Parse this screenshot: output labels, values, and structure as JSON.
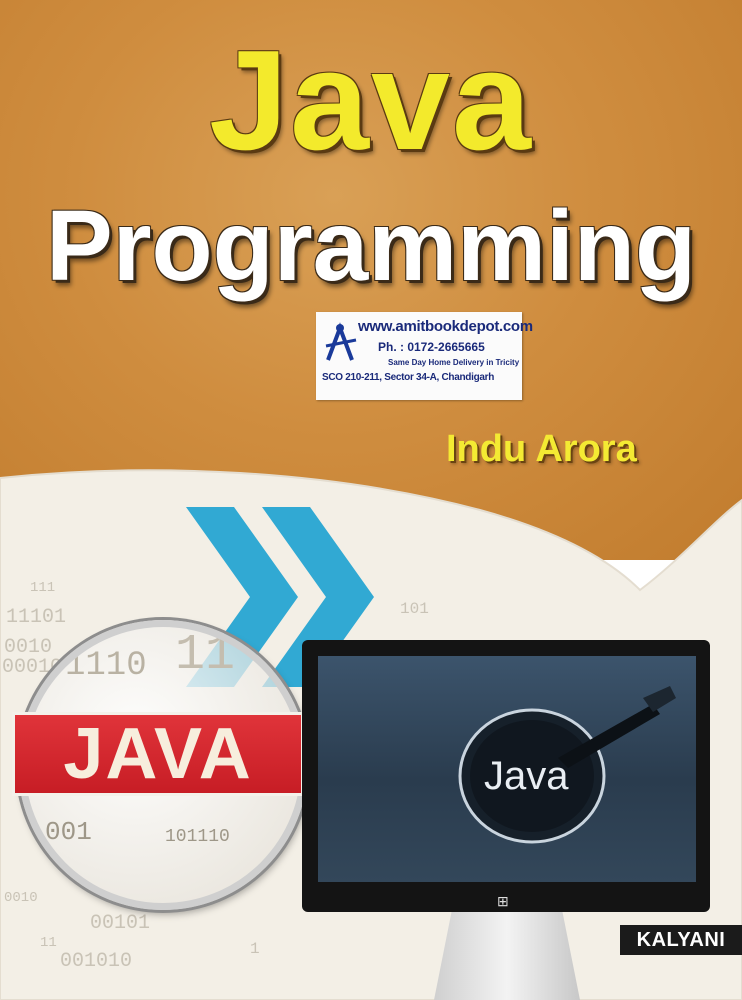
{
  "book": {
    "title_line1": "Java",
    "title_line2": "Programming",
    "author": "Indu Arora",
    "publisher": "KALYANI"
  },
  "sticker": {
    "website": "www.amitbookdepot.com",
    "phone": "Ph. : 0172-2665665",
    "delivery": "Same Day Home Delivery in Tricity",
    "address": "SCO 210-211, Sector 34-A, Chandigarh"
  },
  "graphics": {
    "lens_label": "JAVA",
    "screen_label": "Java"
  },
  "colors": {
    "background_orange": "#c98738",
    "title_yellow": "#f3ea2c",
    "arrow_blue": "#31a9d3",
    "banner_red": "#d42830"
  }
}
